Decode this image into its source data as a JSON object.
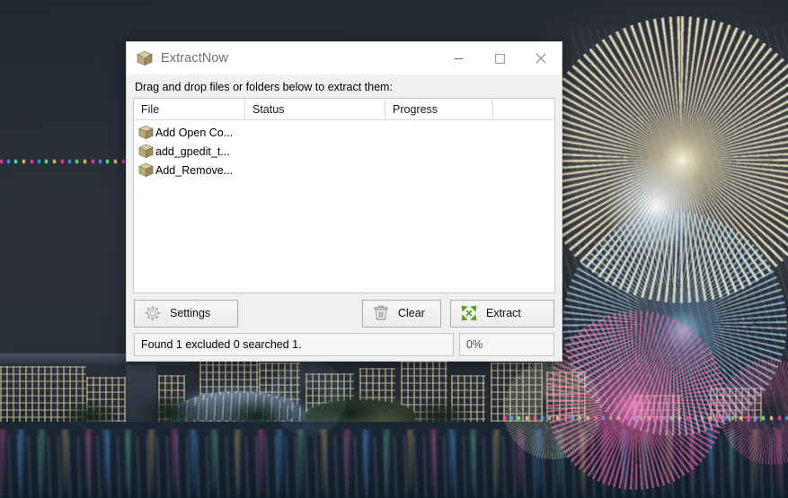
{
  "background": {
    "description": "Singapore Marina Bay skyline at night with fireworks over the water",
    "sky_color": "#262c36",
    "water_color": "#162231",
    "firework_colors": [
      "#fff3cd",
      "#ff69af",
      "#afe1ff"
    ]
  },
  "window": {
    "title": "ExtractNow",
    "icon": "package-box-icon",
    "controls": {
      "minimize": "minimize",
      "maximize": "maximize",
      "close": "close"
    },
    "hint": "Drag and drop files or folders below to extract them:",
    "list": {
      "columns": [
        "File",
        "Status",
        "Progress"
      ],
      "rows": [
        {
          "file": "Add Open Co...",
          "status": "",
          "progress": "",
          "icon": "package-box-icon"
        },
        {
          "file": "add_gpedit_t...",
          "status": "",
          "progress": "",
          "icon": "package-box-icon"
        },
        {
          "file": "Add_Remove...",
          "status": "",
          "progress": "",
          "icon": "package-box-icon"
        }
      ]
    },
    "buttons": {
      "settings": {
        "label": "Settings",
        "icon": "gear-icon"
      },
      "clear": {
        "label": "Clear",
        "icon": "trash-icon"
      },
      "extract": {
        "label": "Extract",
        "icon": "expand-arrows-icon"
      }
    },
    "status": {
      "message": "Found 1 excluded 0 searched 1.",
      "progress_label": "0%",
      "progress_value": 0
    },
    "colors": {
      "chrome": "#f0f0f0",
      "list_bg": "#ffffff",
      "title_text": "#6f6f6f",
      "extract_icon": "#5ca022",
      "close_hover": "#e81123"
    }
  }
}
